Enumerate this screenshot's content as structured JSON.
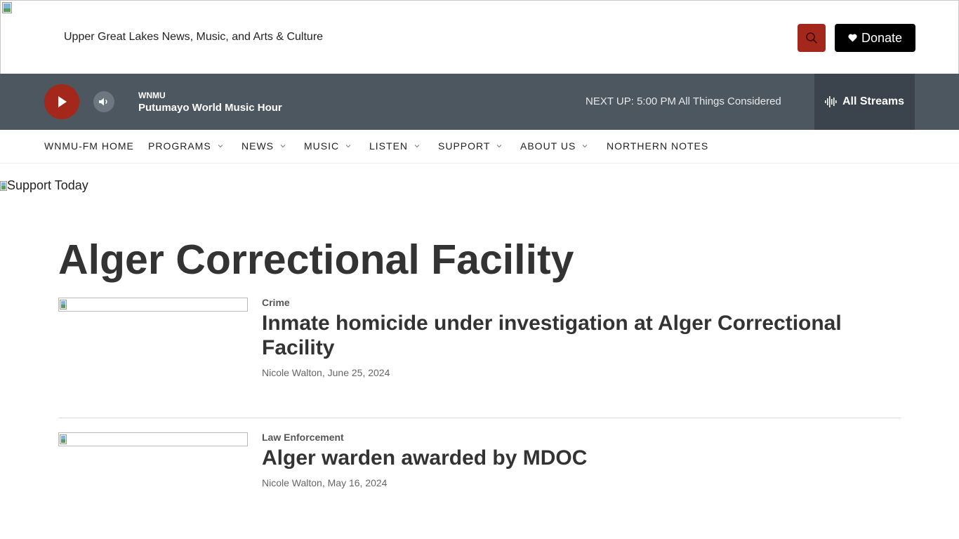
{
  "header": {
    "tagline": "Upper Great Lakes News, Music, and Arts & Culture",
    "search_icon": "search-icon",
    "donate_label": "Donate",
    "donate_icon": "heart-icon",
    "accent": "#a3281b"
  },
  "player": {
    "station": "WNMU",
    "program": "Putumayo World Music Hour",
    "next_up_label": "NEXT UP:",
    "next_up_time": "5:00 PM",
    "next_up_show": "All Things Considered",
    "streams_label": "All Streams",
    "bar_color": "#4d5760"
  },
  "nav": {
    "items": [
      {
        "label": "WNMU-FM HOME",
        "dropdown": false
      },
      {
        "label": "PROGRAMS",
        "dropdown": true
      },
      {
        "label": "NEWS",
        "dropdown": true
      },
      {
        "label": "MUSIC",
        "dropdown": true
      },
      {
        "label": "LISTEN",
        "dropdown": true
      },
      {
        "label": "SUPPORT",
        "dropdown": true
      },
      {
        "label": "ABOUT US",
        "dropdown": true
      },
      {
        "label": "NORTHERN NOTES",
        "dropdown": false
      }
    ]
  },
  "support_alt": "Support Today",
  "page_title": "Alger Correctional Facility",
  "articles": [
    {
      "category": "Crime",
      "headline": "Inmate homicide under investigation at Alger Correctional Facility",
      "byline": "Nicole Walton, June 25, 2024"
    },
    {
      "category": "Law Enforcement",
      "headline": "Alger warden awarded by MDOC",
      "byline": "Nicole Walton, May 16, 2024"
    }
  ]
}
